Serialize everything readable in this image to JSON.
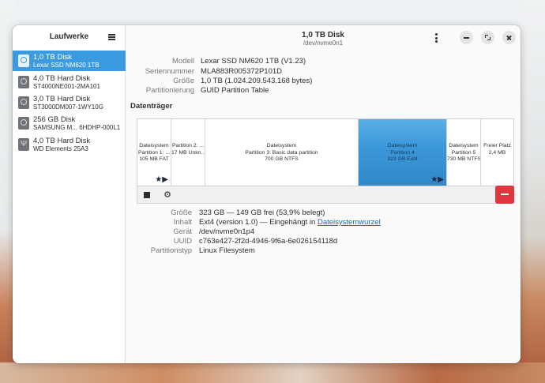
{
  "sidebar": {
    "title": "Laufwerke",
    "items": [
      {
        "name": "1,0 TB Disk",
        "sub": "Lexar SSD NM620 1TB",
        "selected": true,
        "icon": "disk-icon"
      },
      {
        "name": "4,0 TB Hard Disk",
        "sub": "ST4000NE001-2MA101",
        "icon": "disk-icon"
      },
      {
        "name": "3,0 TB Hard Disk",
        "sub": "ST3000DM007-1WY10G",
        "icon": "disk-icon"
      },
      {
        "name": "256 GB Disk",
        "sub": "SAMSUNG M...  6HDHP-000L1",
        "icon": "disk-icon"
      },
      {
        "name": "4,0 TB Hard Disk",
        "sub": "WD Elements 25A3",
        "icon": "usb-icon"
      }
    ]
  },
  "header": {
    "title": "1,0 TB Disk",
    "subtitle": "/dev/nvme0n1"
  },
  "drive_info": [
    {
      "label": "Modell",
      "value": "Lexar SSD NM620 1TB (V1.23)"
    },
    {
      "label": "Seriennummer",
      "value": "MLA883R005372P101D"
    },
    {
      "label": "Größe",
      "value": "1,0 TB (1.024.209.543.168 bytes)"
    },
    {
      "label": "Partitionierung",
      "value": "GUID Partition Table"
    }
  ],
  "volumes_title": "Datenträger",
  "partitions": [
    {
      "line1": "Dateisystem",
      "line2": "Partition 1: ...",
      "line3": "105 MB FAT",
      "icons": "★▶"
    },
    {
      "line1": "Partition 2: ...",
      "line2": "17 MB Unkn...",
      "line3": ""
    },
    {
      "line1": "Dateisystem",
      "line2": "Partition 3: Basic data partition",
      "line3": "700 GB NTFS"
    },
    {
      "line1": "Dateisystem",
      "line2": "Partition 4",
      "line3": "323 GB Ext4",
      "icons": "★▶",
      "selected": true
    },
    {
      "line1": "Dateisystem",
      "line2": "Partition 5",
      "line3": "730 MB NTFS"
    },
    {
      "line1": "Freier Platz",
      "line2": "2,4 MB",
      "line3": ""
    }
  ],
  "partition_info": {
    "size_label": "Größe",
    "size_value": "323 GB — 149 GB frei (53,9% belegt)",
    "content_label": "Inhalt",
    "content_value": "Ext4 (version 1.0) — Eingehängt in ",
    "content_link": "Dateisystemwurzel",
    "device_label": "Gerät",
    "device_value": "/dev/nvme0n1p4",
    "uuid_label": "UUID",
    "uuid_value": "c763e427-2f2d-4946-9f6a-6e026154118d",
    "type_label": "Partitionstyp",
    "type_value": "Linux Filesystem"
  },
  "toolbar": {
    "gear_glyph": "⚙"
  },
  "colors": {
    "accent": "#3c9ae0",
    "delete": "#e0363f"
  }
}
